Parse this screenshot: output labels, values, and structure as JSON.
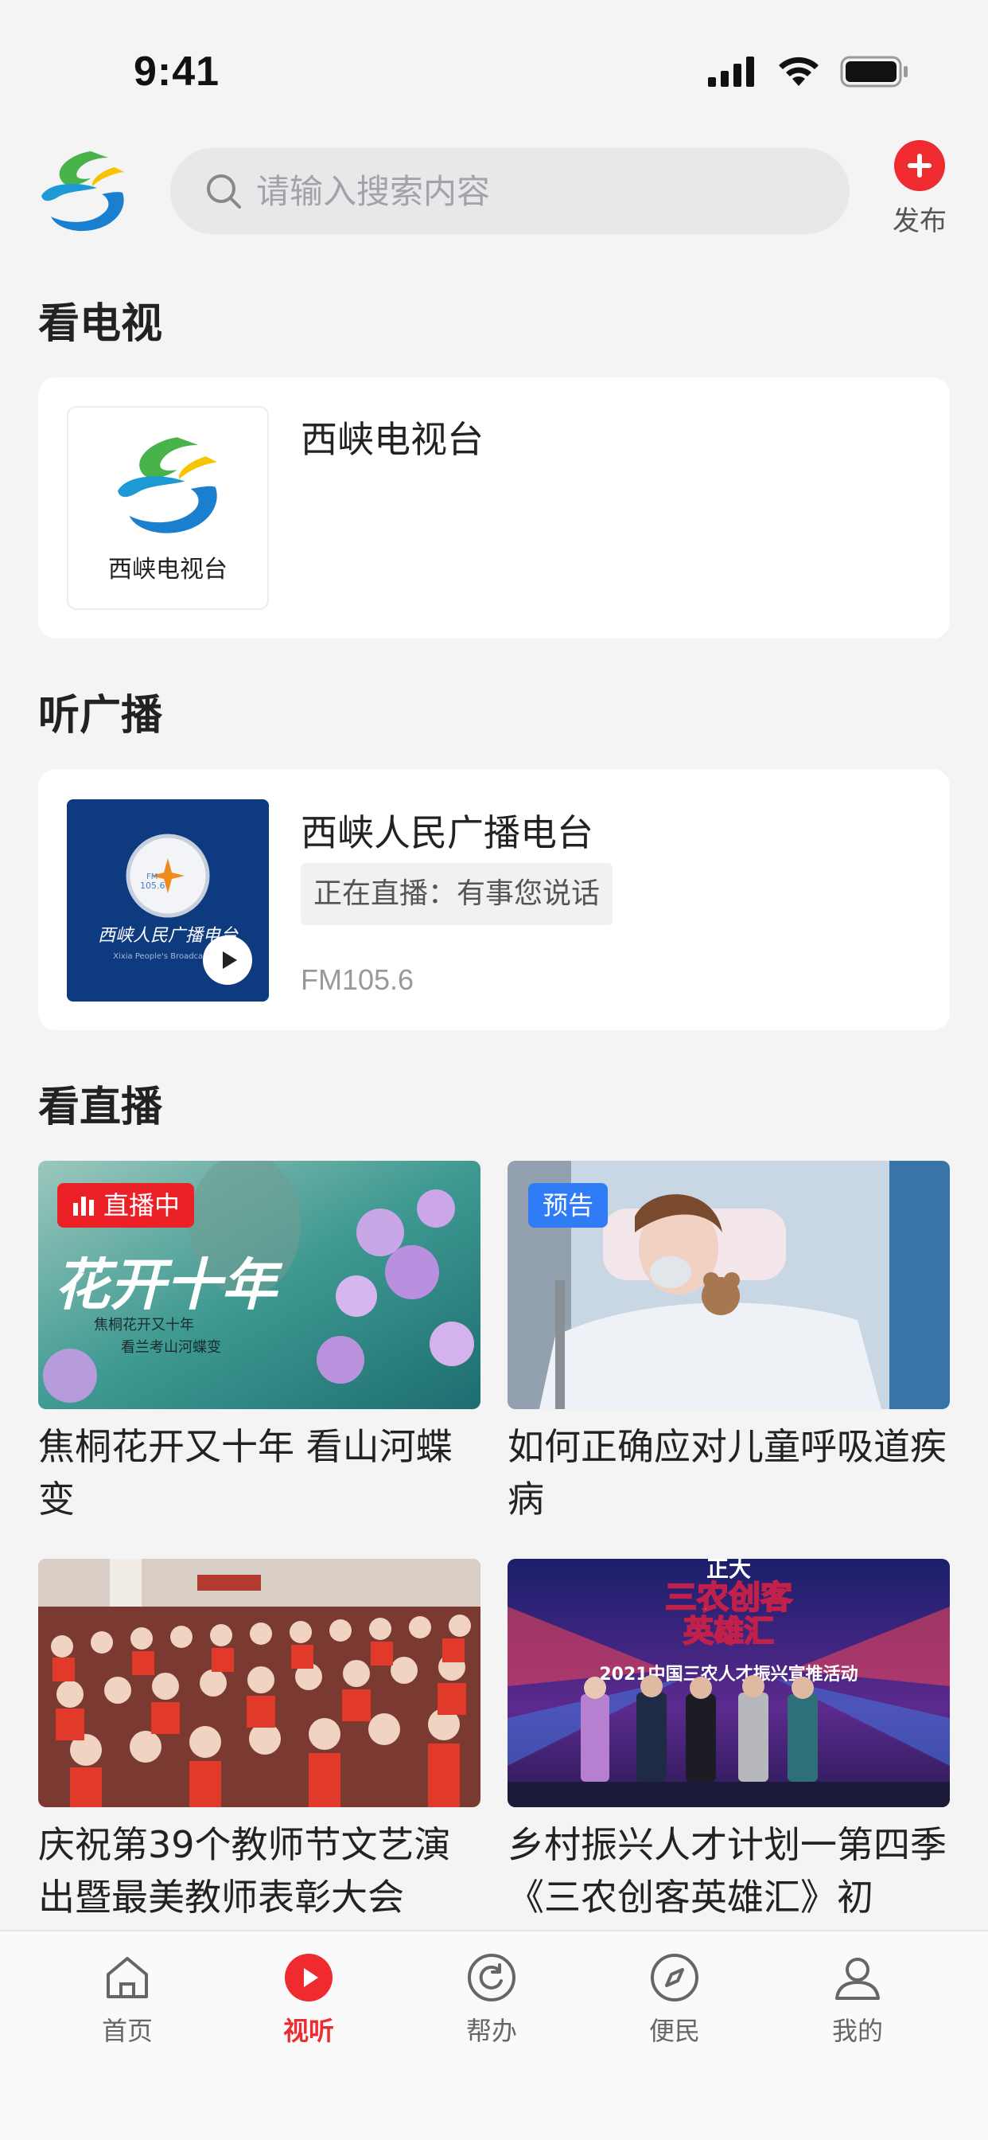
{
  "status_bar": {
    "time": "9:41"
  },
  "header": {
    "search_placeholder": "请输入搜索内容",
    "publish_label": "发布"
  },
  "tv_section": {
    "title": "看电视",
    "station_name": "西峡电视台",
    "logo_text": "西峡电视台"
  },
  "radio_section": {
    "title": "听广播",
    "station_name": "西峡人民广播电台",
    "now_playing": "正在直播：有事您说话",
    "frequency": "FM105.6",
    "logo_fm": "FM\n105.6",
    "logo_script": "西峡人民广播电台",
    "logo_english": "Xixia People's Broadcasting"
  },
  "live_section": {
    "title": "看直播",
    "items": [
      {
        "title": "焦桐花开又十年 看山河蝶变",
        "badge": "直播中",
        "badge_type": "live",
        "overlay_big": "花开十年",
        "overlay_sub1": "焦桐花开又十年",
        "overlay_sub2": "看兰考山河蝶变"
      },
      {
        "title": "如何正确应对儿童呼吸道疾病",
        "badge": "预告",
        "badge_type": "preview"
      },
      {
        "title": "庆祝第39个教师节文艺演出暨最美教师表彰大会"
      },
      {
        "title": "乡村振兴人才计划一第四季《三农创客英雄汇》初",
        "overlay_big1": "三农创客",
        "overlay_big2": "英雄汇",
        "overlay_sub": "2021中国三农人才振兴宣推活动",
        "overlay_top": "正大"
      }
    ]
  },
  "tabbar": {
    "items": [
      {
        "label": "首页",
        "icon": "home-icon"
      },
      {
        "label": "视听",
        "icon": "play-icon",
        "active": true
      },
      {
        "label": "帮办",
        "icon": "refresh-icon"
      },
      {
        "label": "便民",
        "icon": "compass-icon"
      },
      {
        "label": "我的",
        "icon": "user-icon"
      }
    ]
  },
  "colors": {
    "accent": "#ef2b30",
    "live_badge": "#ec2027",
    "preview_badge": "#2f7cf6",
    "background": "#f4f4f5"
  }
}
